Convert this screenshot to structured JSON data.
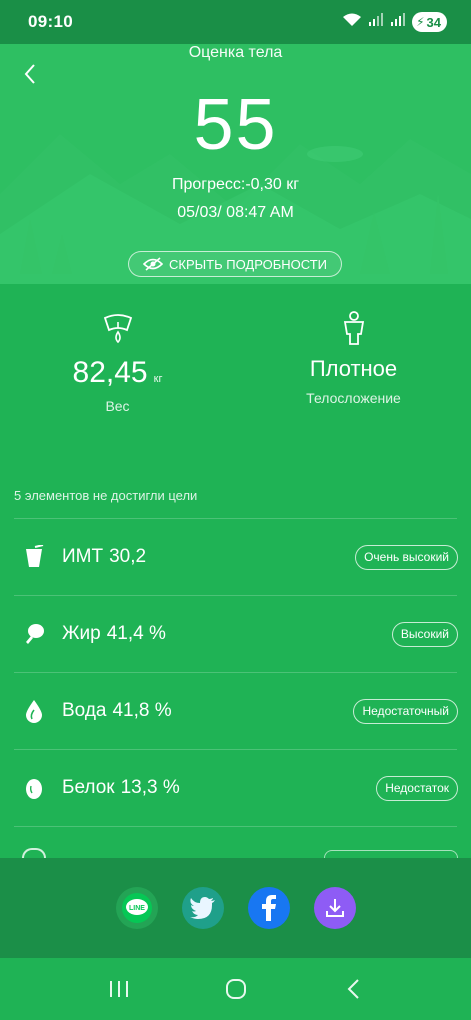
{
  "status_bar": {
    "time": "09:10",
    "battery": "34"
  },
  "header": {
    "title": "Оценка тела",
    "score": "55",
    "progress": "Прогресс:-0,30 кг",
    "datetime": "05/03/ 08:47 AM",
    "hide_details_label": "СКРЫТЬ ПОДРОБНОСТИ"
  },
  "metrics": {
    "weight": {
      "value": "82,45",
      "unit": "кг",
      "label": "Вес"
    },
    "body_type": {
      "value": "Плотное",
      "label": "Телосложение"
    }
  },
  "goals": {
    "header": "5 элементов не достигли цели",
    "items": [
      {
        "name": "ИМТ",
        "value": "30,2",
        "status": "Очень высокий",
        "icon": "bmi-cup-icon"
      },
      {
        "name": "Жир",
        "value": "41,4 %",
        "status": "Высокий",
        "icon": "drumstick-icon"
      },
      {
        "name": "Вода",
        "value": "41,8 %",
        "status": "Недостаточный",
        "icon": "water-drop-icon"
      },
      {
        "name": "Белок",
        "value": "13,3 %",
        "status": "Недостаток",
        "icon": "egg-icon"
      }
    ]
  },
  "share": {
    "buttons": [
      {
        "name": "line",
        "label": "LINE",
        "color": "#06c755"
      },
      {
        "name": "twitter",
        "color": "#1da1f2"
      },
      {
        "name": "facebook",
        "color": "#1877f2"
      },
      {
        "name": "download",
        "color": "#8e5cf5"
      }
    ]
  },
  "colors": {
    "primary": "#1fb355",
    "dark": "#1a8f47",
    "hero": "#2ebf62"
  }
}
